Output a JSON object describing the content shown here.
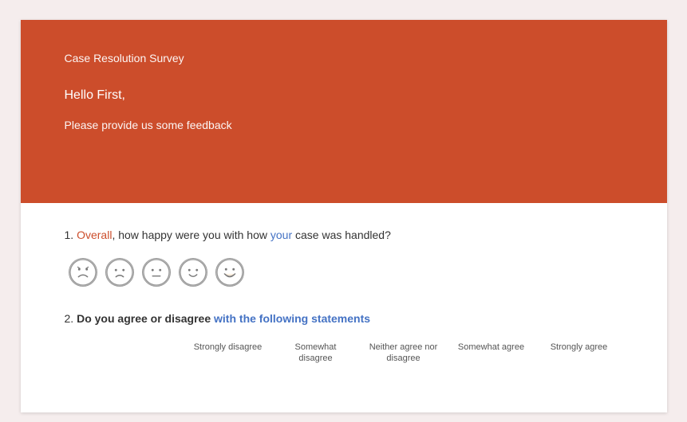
{
  "header": {
    "title": "Case Resolution Survey",
    "greeting": "Hello First,",
    "subtitle": "Please provide us some feedback",
    "bg_color": "#cc4d2b"
  },
  "questions": [
    {
      "number": "1.",
      "text_parts": [
        {
          "text": "Overall",
          "style": "highlight"
        },
        {
          "text": ", how happy were you with how "
        },
        {
          "text": "your",
          "style": "highlight-blue"
        },
        {
          "text": " case was handled?"
        }
      ],
      "type": "emoji",
      "emojis": [
        {
          "label": "very-sad",
          "face": "sad"
        },
        {
          "label": "sad",
          "face": "slightly-sad"
        },
        {
          "label": "neutral",
          "face": "neutral"
        },
        {
          "label": "happy",
          "face": "slightly-happy"
        },
        {
          "label": "very-happy",
          "face": "very-happy"
        }
      ]
    },
    {
      "number": "2.",
      "text": "Do you agree or disagree with the following statements",
      "type": "scale",
      "scale_labels": [
        {
          "text": "Strongly disagree",
          "line2": ""
        },
        {
          "text": "Somewhat",
          "line2": "disagree"
        },
        {
          "text": "Neither agree nor",
          "line2": "disagree"
        },
        {
          "text": "Somewhat agree",
          "line2": ""
        },
        {
          "text": "Strongly agree",
          "line2": ""
        }
      ]
    }
  ],
  "emojis": {
    "very_sad_unicode": "😞",
    "sad_unicode": "😕",
    "neutral_unicode": "😐",
    "happy_unicode": "🙂",
    "very_happy_unicode": "😊"
  }
}
